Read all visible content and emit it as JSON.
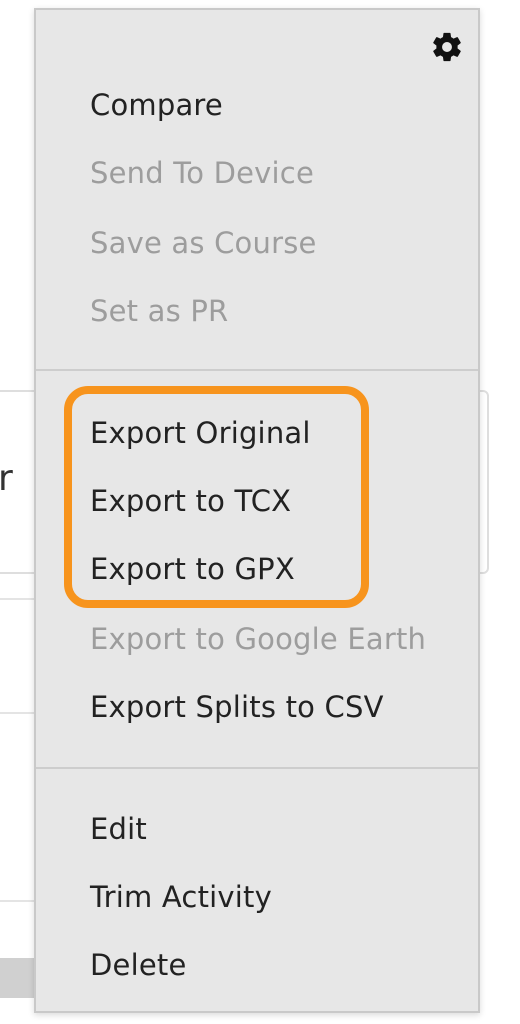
{
  "background": {
    "partial_text": "r"
  },
  "menu": {
    "settings_icon": "gear-icon",
    "groups": [
      {
        "items": [
          {
            "label": "Compare",
            "enabled": true
          },
          {
            "label": "Send To Device",
            "enabled": false
          },
          {
            "label": "Save as Course",
            "enabled": false
          },
          {
            "label": "Set as PR",
            "enabled": false
          }
        ]
      },
      {
        "items": [
          {
            "label": "Export Original",
            "enabled": true
          },
          {
            "label": "Export to TCX",
            "enabled": true
          },
          {
            "label": "Export to GPX",
            "enabled": true
          },
          {
            "label": "Export to Google Earth",
            "enabled": false
          },
          {
            "label": "Export Splits to CSV",
            "enabled": true
          }
        ]
      },
      {
        "items": [
          {
            "label": "Edit",
            "enabled": true
          },
          {
            "label": "Trim Activity",
            "enabled": true
          },
          {
            "label": "Delete",
            "enabled": true
          }
        ]
      }
    ]
  },
  "colors": {
    "menu_background": "#e7e7e7",
    "enabled_text": "#222222",
    "disabled_text": "#9d9d9d",
    "highlight": "#f7941d"
  }
}
